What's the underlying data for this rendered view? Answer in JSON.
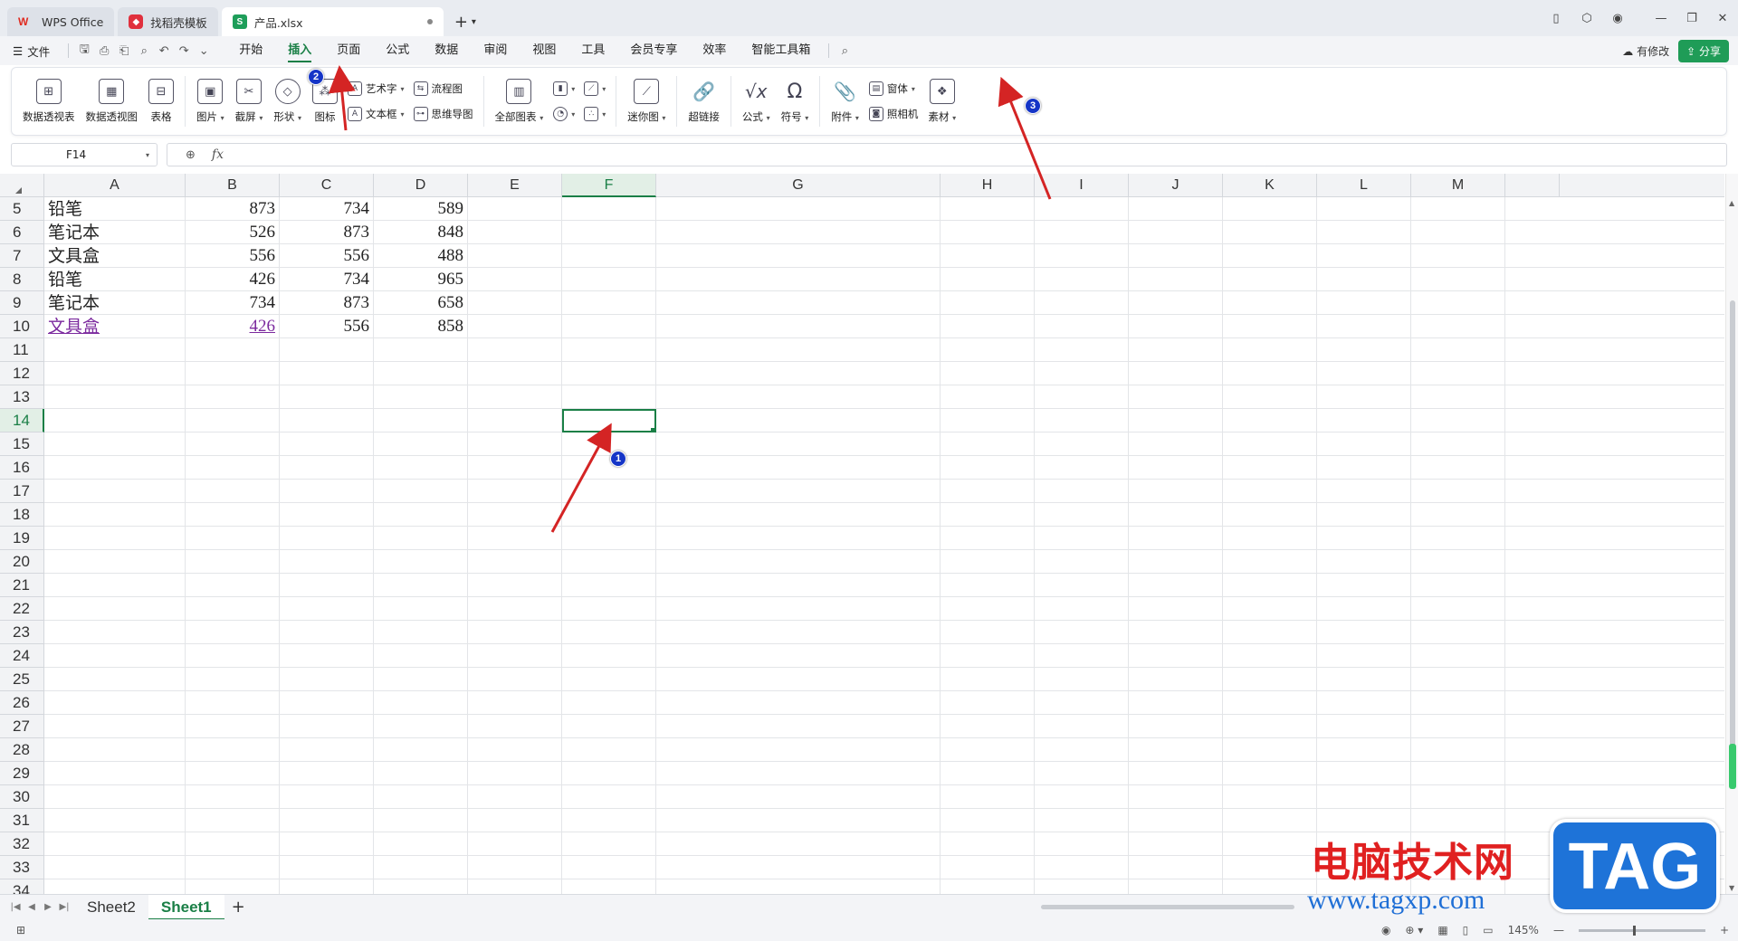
{
  "tabs": [
    {
      "label": "WPS Office",
      "icon": "wps-logo-icon"
    },
    {
      "label": "找稻壳模板",
      "icon": "template-logo-icon"
    },
    {
      "label": "产品.xlsx",
      "icon": "spreadsheet-icon"
    }
  ],
  "menu": {
    "file": "文件",
    "tabs": [
      "开始",
      "插入",
      "页面",
      "公式",
      "数据",
      "审阅",
      "视图",
      "工具",
      "会员专享",
      "效率",
      "智能工具箱"
    ],
    "active_tab": "插入",
    "modified": "有修改",
    "share": "分享"
  },
  "ribbon": {
    "pivot_table": "数据透视表",
    "pivot_chart": "数据透视图",
    "table": "表格",
    "picture": "图片",
    "screenshot": "截屏",
    "shape": "形状",
    "icon": "图标",
    "wordart": "艺术字",
    "textbox": "文本框",
    "flowchart": "流程图",
    "mindmap": "思维导图",
    "all_charts": "全部图表",
    "sparkline": "迷你图",
    "hyperlink": "超链接",
    "formula": "公式",
    "symbol": "符号",
    "attachment": "附件",
    "form": "窗体",
    "camera": "照相机",
    "material": "素材"
  },
  "formula_bar": {
    "cell_ref": "F14",
    "fx": "fx"
  },
  "grid": {
    "columns": [
      "A",
      "B",
      "C",
      "D",
      "E",
      "F",
      "G",
      "H",
      "I",
      "J",
      "K",
      "L",
      "M"
    ],
    "selected_column": "F",
    "selected_row": "14",
    "rows": [
      {
        "num": "5",
        "cells": [
          "铅笔",
          "873",
          "734",
          "589"
        ]
      },
      {
        "num": "6",
        "cells": [
          "笔记本",
          "526",
          "873",
          "848"
        ]
      },
      {
        "num": "7",
        "cells": [
          "文具盒",
          "556",
          "556",
          "488"
        ]
      },
      {
        "num": "8",
        "cells": [
          "铅笔",
          "426",
          "734",
          "965"
        ]
      },
      {
        "num": "9",
        "cells": [
          "笔记本",
          "734",
          "873",
          "658"
        ]
      },
      {
        "num": "10",
        "cells": [
          "文具盒",
          "426",
          "556",
          "858"
        ]
      },
      {
        "num": "11",
        "cells": []
      },
      {
        "num": "12",
        "cells": []
      },
      {
        "num": "13",
        "cells": []
      },
      {
        "num": "14",
        "cells": []
      },
      {
        "num": "15",
        "cells": []
      },
      {
        "num": "16",
        "cells": []
      },
      {
        "num": "17",
        "cells": []
      },
      {
        "num": "18",
        "cells": []
      },
      {
        "num": "19",
        "cells": []
      },
      {
        "num": "20",
        "cells": []
      },
      {
        "num": "21",
        "cells": []
      },
      {
        "num": "22",
        "cells": []
      },
      {
        "num": "23",
        "cells": []
      },
      {
        "num": "24",
        "cells": []
      },
      {
        "num": "25",
        "cells": []
      },
      {
        "num": "26",
        "cells": []
      },
      {
        "num": "27",
        "cells": []
      },
      {
        "num": "28",
        "cells": []
      },
      {
        "num": "29",
        "cells": []
      },
      {
        "num": "30",
        "cells": []
      },
      {
        "num": "31",
        "cells": []
      },
      {
        "num": "32",
        "cells": []
      },
      {
        "num": "33",
        "cells": []
      },
      {
        "num": "34",
        "cells": []
      }
    ]
  },
  "sheets": [
    "Sheet2",
    "Sheet1"
  ],
  "active_sheet": "Sheet1",
  "status": {
    "zoom": "145%"
  },
  "annotations": [
    "1",
    "2",
    "3"
  ],
  "watermark": {
    "cn": "电脑技术网",
    "url": "www.tagxp.com",
    "tag": "TAG"
  },
  "colors": {
    "accent": "#1a7f46",
    "link": "#7b2a9e",
    "badge": "#1535c7",
    "arrow": "#d42424"
  }
}
